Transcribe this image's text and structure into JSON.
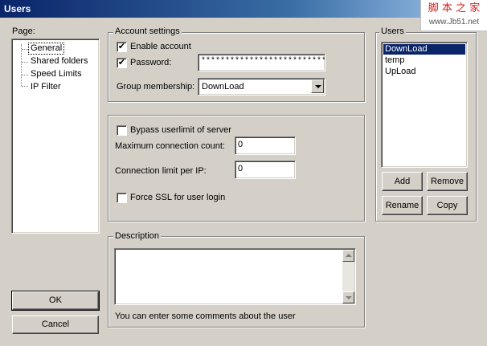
{
  "window": {
    "title": "Users"
  },
  "watermark": {
    "line1": "脚 本 之 家",
    "line2": "www.Jb51.net"
  },
  "page_panel": {
    "label": "Page:",
    "items": [
      "General",
      "Shared folders",
      "Speed Limits",
      "IP Filter"
    ],
    "selected": "General"
  },
  "account_settings": {
    "group_label": "Account settings",
    "enable_account_label": "Enable account",
    "enable_account_checked": true,
    "password_label": "Password:",
    "password_checked": true,
    "password_value": "****************************",
    "group_membership_label": "Group membership:",
    "group_membership_value": "DownLoad"
  },
  "limits": {
    "bypass_label": "Bypass userlimit of server",
    "bypass_checked": false,
    "max_conn_label": "Maximum connection count:",
    "max_conn_value": "0",
    "conn_per_ip_label": "Connection limit per IP:",
    "conn_per_ip_value": "0",
    "force_ssl_label": "Force SSL for user login",
    "force_ssl_checked": false
  },
  "description": {
    "group_label": "Description",
    "value": "",
    "hint": "You can enter some comments about the user"
  },
  "users_panel": {
    "group_label": "Users",
    "users": [
      "DownLoad",
      "temp",
      "UpLoad"
    ],
    "selected": "DownLoad",
    "add_label": "Add",
    "remove_label": "Remove",
    "rename_label": "Rename",
    "copy_label": "Copy"
  },
  "buttons": {
    "ok_label": "OK",
    "cancel_label": "Cancel"
  },
  "colors": {
    "face": "#d4d0c8",
    "selection": "#0a246a",
    "title_start": "#0a246a"
  }
}
